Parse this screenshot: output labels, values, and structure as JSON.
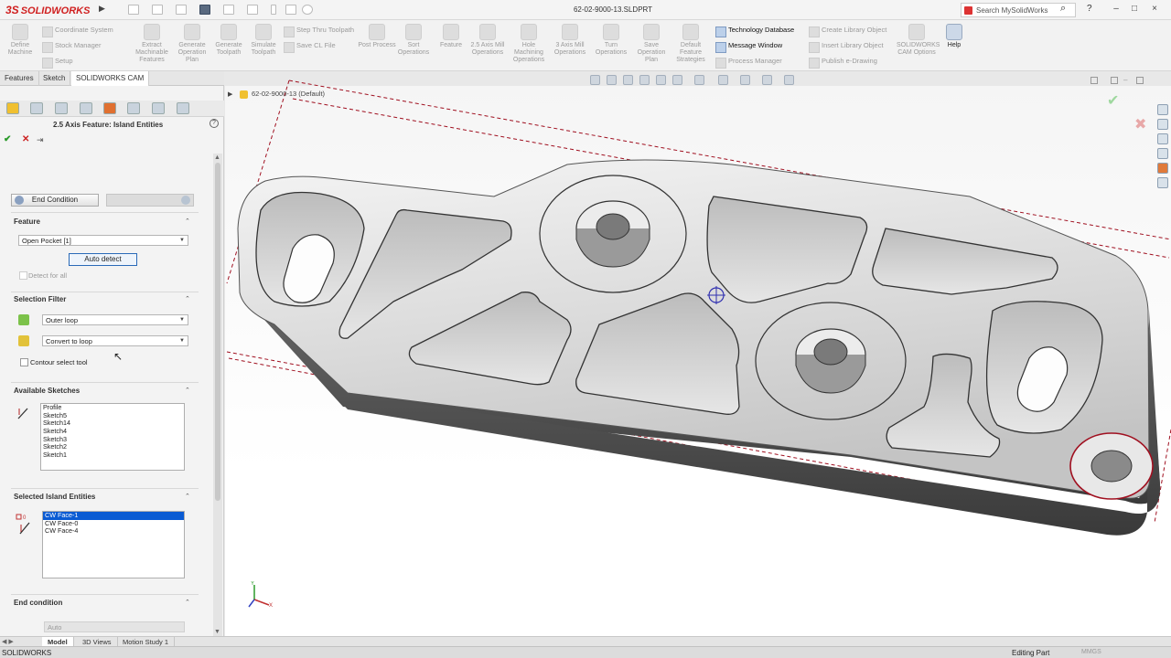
{
  "titlebar": {
    "brand": "SOLIDWORKS",
    "brand_prefix": "3S",
    "document": "62-02-9000-13.SLDPRT",
    "search_placeholder": "Search MySolidWorks",
    "help": "?",
    "win_min": "–",
    "win_max": "□",
    "win_close": "×"
  },
  "commands": {
    "left_small": [
      "Coordinate System",
      "Stock Manager",
      "Setup"
    ],
    "define_machine": "Define Machine",
    "buttons": [
      {
        "label": "Extract Machinable Features",
        "enabled": false
      },
      {
        "label": "Generate Operation Plan",
        "enabled": false
      },
      {
        "label": "Generate Toolpath",
        "enabled": false
      },
      {
        "label": "Simulate Toolpath",
        "enabled": false
      }
    ],
    "mid_small": [
      "Step Thru Toolpath",
      "Save CL File"
    ],
    "buttons2": [
      {
        "label": "Post Process",
        "enabled": false
      },
      {
        "label": "Sort Operations",
        "enabled": false
      },
      {
        "label": "Feature",
        "enabled": false
      },
      {
        "label": "2.5 Axis Mill Operations",
        "enabled": false
      },
      {
        "label": "Hole Machining Operations",
        "enabled": false
      },
      {
        "label": "3 Axis Mill Operations",
        "enabled": false
      },
      {
        "label": "Turn Operations",
        "enabled": false
      },
      {
        "label": "Save Operation Plan",
        "enabled": false
      },
      {
        "label": "Default Feature Strategies",
        "enabled": false
      }
    ],
    "right_small": [
      {
        "label": "Technology Database",
        "enabled": true
      },
      {
        "label": "Message Window",
        "enabled": true
      },
      {
        "label": "Process Manager",
        "enabled": false
      }
    ],
    "right_small2": [
      "Create Library Object",
      "Insert Library Object",
      "Publish e-Drawing"
    ],
    "cam_options": "SOLIDWORKS CAM Options",
    "help_button": "Help"
  },
  "tabs": [
    "Features",
    "Sketch",
    "SOLIDWORKS CAM"
  ],
  "property_manager": {
    "title": "2.5 Axis Feature: Island Entities",
    "ok": "✔",
    "cancel": "✕",
    "pin": "⇥",
    "end_condition_btn": "End Condition",
    "feature": {
      "header": "Feature",
      "selected": "Open Pocket [1]",
      "auto_detect": "Auto detect",
      "detect_for_all": "Detect for all"
    },
    "selection_filter": {
      "header": "Selection Filter",
      "filter1": "Outer loop",
      "filter2": "Convert to loop",
      "contour_tool": "Contour select tool"
    },
    "available_sketches": {
      "header": "Available Sketches",
      "items": [
        "Profile",
        "Sketch5",
        "Sketch14",
        "Sketch4",
        "Sketch3",
        "Sketch2",
        "Sketch1"
      ]
    },
    "selected_island": {
      "header": "Selected Island Entities",
      "items": [
        "CW Face-1",
        "CW Face-0",
        "CW Face-4"
      ],
      "selected_index": 0
    },
    "end_condition": {
      "header": "End condition",
      "value": "Auto"
    }
  },
  "view": {
    "tree_item": "62-02-9000-13 (Default)"
  },
  "bottom_tabs": [
    "Model",
    "3D Views",
    "Motion Study 1"
  ],
  "status": {
    "app": "SOLIDWORKS",
    "mode": "Editing Part",
    "units": "MMGS"
  },
  "colors": {
    "accent": "#0a5bd3",
    "selection_red": "#a01020"
  }
}
